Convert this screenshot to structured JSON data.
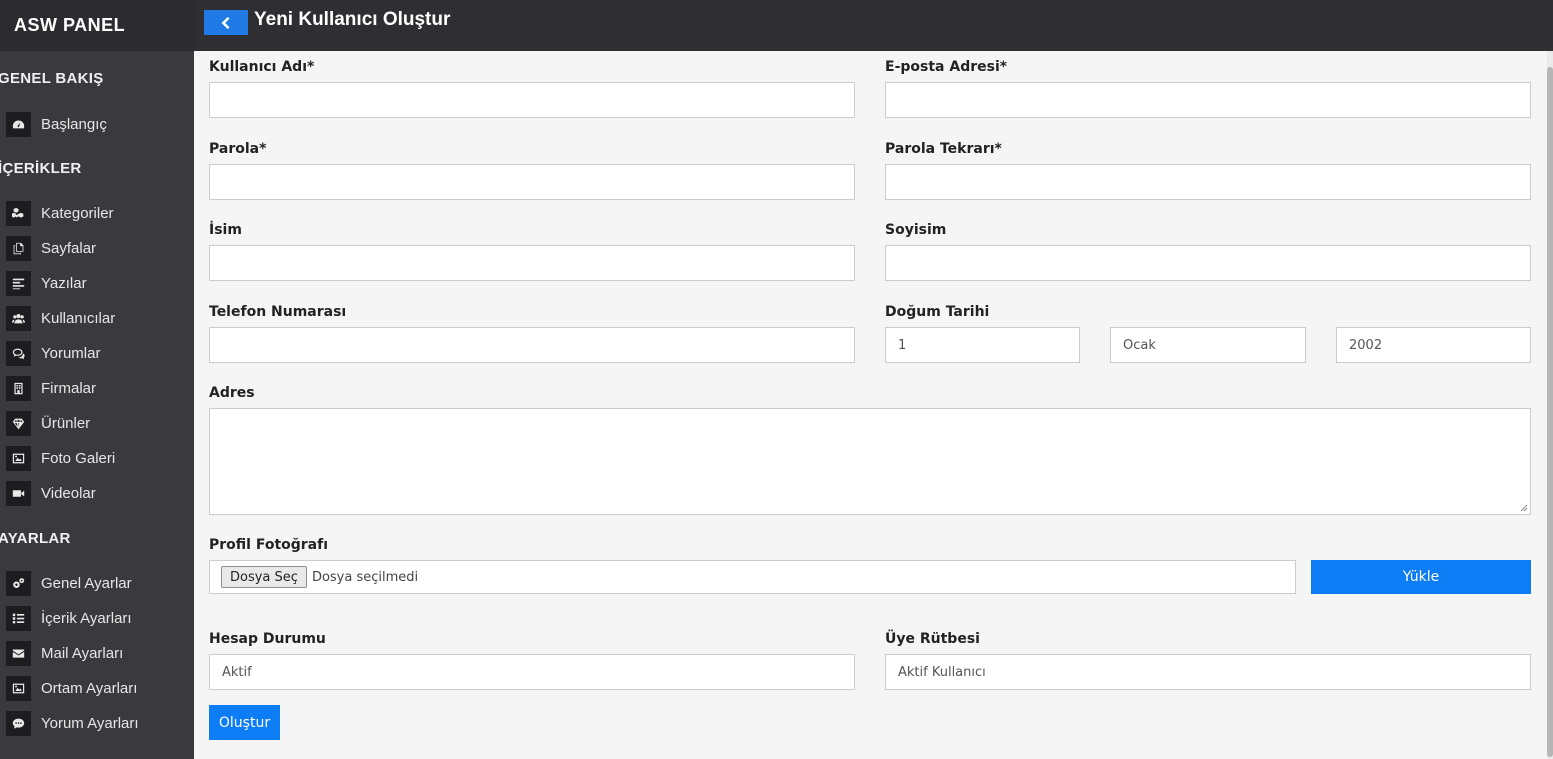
{
  "brand": "ASW PANEL",
  "header": {
    "title": "Yeni Kullanıcı Oluştur"
  },
  "sidebar": {
    "sections": [
      {
        "title": "GENEL BAKIŞ",
        "items": [
          {
            "label": "Başlangıç",
            "icon": "dashboard-icon"
          }
        ]
      },
      {
        "title": "İÇERİKLER",
        "items": [
          {
            "label": "Kategoriler",
            "icon": "cubes-icon"
          },
          {
            "label": "Sayfalar",
            "icon": "copy-icon"
          },
          {
            "label": "Yazılar",
            "icon": "align-left-icon"
          },
          {
            "label": "Kullanıcılar",
            "icon": "users-icon"
          },
          {
            "label": "Yorumlar",
            "icon": "comments-icon"
          },
          {
            "label": "Firmalar",
            "icon": "building-icon"
          },
          {
            "label": "Ürünler",
            "icon": "diamond-icon"
          },
          {
            "label": "Foto Galeri",
            "icon": "image-icon"
          },
          {
            "label": "Videolar",
            "icon": "video-icon"
          }
        ]
      },
      {
        "title": "AYARLAR",
        "items": [
          {
            "label": "Genel Ayarlar",
            "icon": "cogs-icon"
          },
          {
            "label": "İçerik Ayarları",
            "icon": "list-icon"
          },
          {
            "label": "Mail Ayarları",
            "icon": "envelope-icon"
          },
          {
            "label": "Ortam Ayarları",
            "icon": "image-icon"
          },
          {
            "label": "Yorum Ayarları",
            "icon": "comment-icon"
          }
        ]
      }
    ]
  },
  "form": {
    "username_label": "Kullanıcı Adı*",
    "email_label": "E-posta Adresi*",
    "password_label": "Parola*",
    "password_repeat_label": "Parola Tekrarı*",
    "first_name_label": "İsim",
    "last_name_label": "Soyisim",
    "phone_label": "Telefon Numarası",
    "birth_label": "Doğum Tarihi",
    "birth_day": "1",
    "birth_month": "Ocak",
    "birth_year": "2002",
    "address_label": "Adres",
    "photo_label": "Profil Fotoğrafı",
    "file_button": "Dosya Seç",
    "file_status": "Dosya seçilmedi",
    "upload_button": "Yükle",
    "account_status_label": "Hesap Durumu",
    "account_status_value": "Aktif",
    "member_rank_label": "Üye Rütbesi",
    "member_rank_value": "Aktif Kullanıcı",
    "submit_button": "Oluştur"
  },
  "colors": {
    "accent": "#0d7df5",
    "sidebar_bg": "#3a3a3e",
    "header_bg": "#2f2f33"
  }
}
